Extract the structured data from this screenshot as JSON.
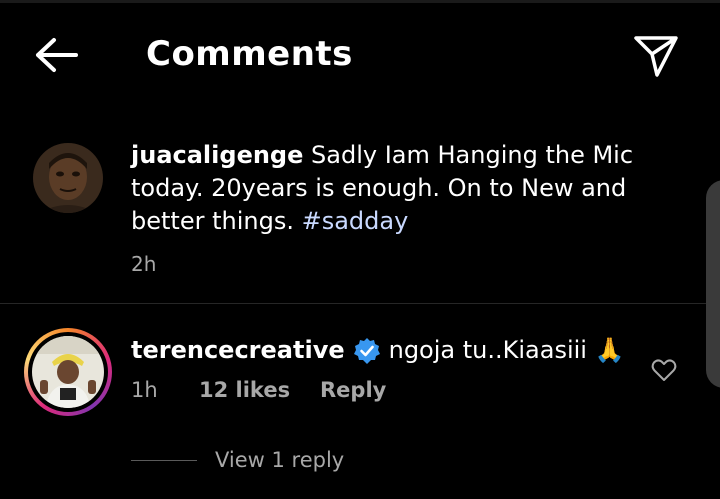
{
  "header": {
    "title": "Comments",
    "back_icon": "arrow-left-icon",
    "send_icon": "paper-plane-icon"
  },
  "caption": {
    "username": "juacaligenge",
    "text": "Sadly Iam Hanging the Mic today. 20years is enough. On to New and better things.",
    "hashtag": "#sadday",
    "time": "2h"
  },
  "comment": {
    "username": "terencecreative",
    "verified_icon": "verified-badge-icon",
    "text": "ngoja tu..Kiaasiii 🙏",
    "time": "1h",
    "likes": "12 likes",
    "reply_label": "Reply",
    "view_replies": "View 1 reply",
    "heart_icon": "heart-outline-icon"
  },
  "colors": {
    "background": "#000000",
    "secondary_text": "#a8a8a8",
    "verified": "#3897f0",
    "hashtag": "#c9d9ff"
  }
}
